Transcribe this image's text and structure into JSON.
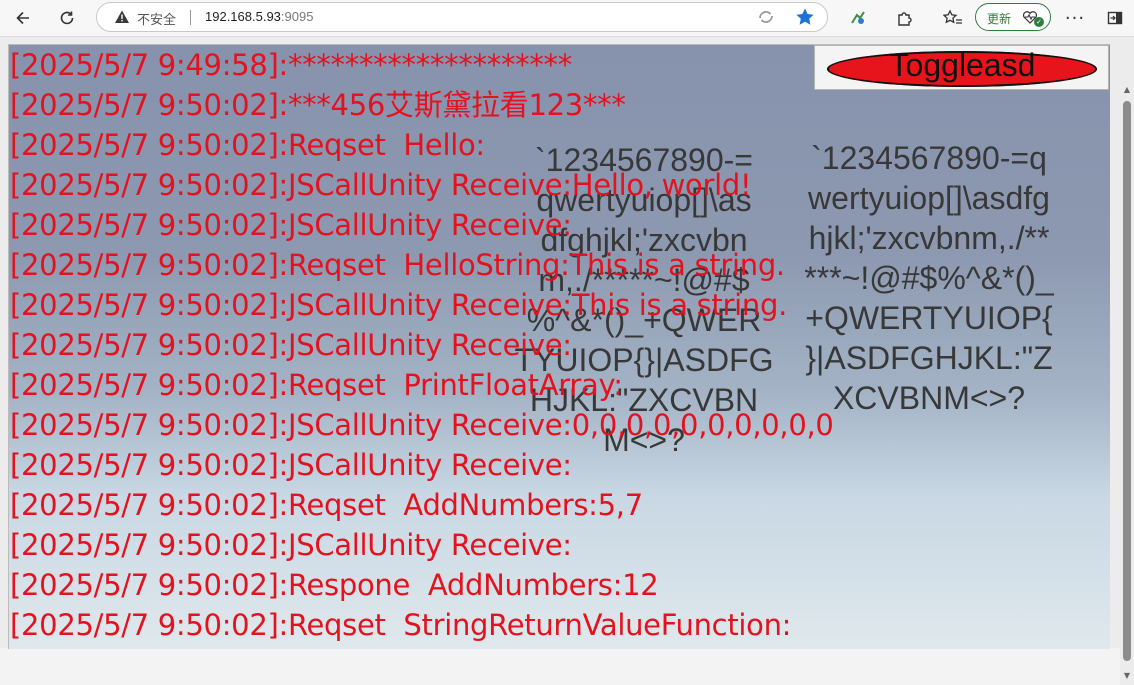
{
  "browser": {
    "back_icon": "arrow-left-icon",
    "refresh_icon": "refresh-icon",
    "security_warning": "不安全",
    "url_host": "192.168.5.93",
    "url_port": ":9095",
    "update_label": "更新",
    "more_icon": "more-icon"
  },
  "unity": {
    "toggle_label": "Toggleasd",
    "toggle_color": "#e8141c",
    "log_color": "#e4121e",
    "log_lines": [
      "[2025/5/7 9:49:58]:********************",
      "[2025/5/7 9:50:02]:***456艾斯黛拉看123***",
      "[2025/5/7 9:50:02]:Reqset  Hello:",
      "[2025/5/7 9:50:02]:JSCallUnity Receive:Hello, world!",
      "[2025/5/7 9:50:02]:JSCallUnity Receive:",
      "[2025/5/7 9:50:02]:Reqset  HelloString:This is a string.",
      "[2025/5/7 9:50:02]:JSCallUnity Receive:This is a string.",
      "[2025/5/7 9:50:02]:JSCallUnity Receive:",
      "[2025/5/7 9:50:02]:Reqset  PrintFloatArray:",
      "[2025/5/7 9:50:02]:JSCallUnity Receive:0,0,0,0,0,0,0,0,0,0",
      "[2025/5/7 9:50:02]:JSCallUnity Receive:",
      "[2025/5/7 9:50:02]:Reqset  AddNumbers:5,7",
      "[2025/5/7 9:50:02]:JSCallUnity Receive:",
      "[2025/5/7 9:50:02]:Respone  AddNumbers:12",
      "[2025/5/7 9:50:02]:Reqset  StringReturnValueFunction:"
    ],
    "glyph_text_left": [
      "`1234567890-=",
      "qwertyuiop[]\\as",
      "dfghjkl;'zxcvbn",
      "m,./*****~!@#$",
      "%^&*()_+QWER",
      "TYUIOP{}|ASDFG",
      "HJKL:\"ZXCVBN",
      "M<>?"
    ],
    "glyph_text_right": [
      "`1234567890-=q",
      "wertyuiop[]\\asdfg",
      "hjkl;'zxcvbnm,./**",
      "***~!@#$%^&*()_",
      "+QWERTYUIOP{",
      "}|ASDFGHJKL:\"Z",
      "XCVBNM<>?"
    ]
  }
}
